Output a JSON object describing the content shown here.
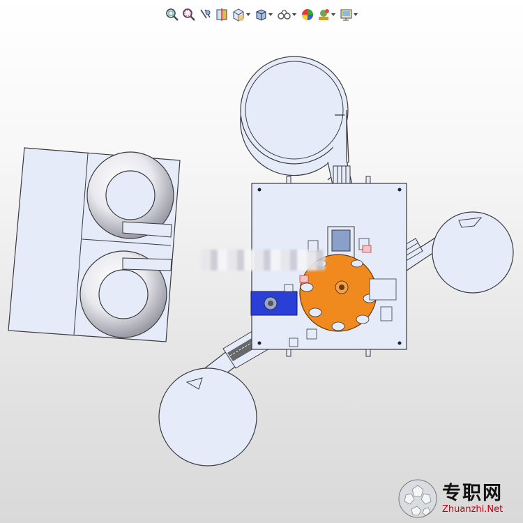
{
  "toolbar": {
    "buttons": [
      {
        "icon": "zoom-to-fit-icon"
      },
      {
        "icon": "zoom-to-area-icon"
      },
      {
        "icon": "previous-view-icon"
      },
      {
        "icon": "section-view-icon"
      },
      {
        "icon": "view-orientation-icon",
        "dropdown": true
      },
      {
        "icon": "display-style-icon",
        "dropdown": true
      },
      {
        "icon": "hide-show-items-icon",
        "dropdown": true
      },
      {
        "icon": "edit-appearance-icon"
      },
      {
        "icon": "apply-scene-icon",
        "dropdown": true
      },
      {
        "icon": "view-settings-icon",
        "dropdown": true
      }
    ]
  },
  "colors": {
    "part_fill": "#e6ebfa",
    "part_stroke": "#3a3a3a",
    "turntable": "#f08a1f",
    "motor_block": "#2a3fd6"
  },
  "watermark": {
    "chinese": "专职网",
    "english": "Zhuanzhi.Net"
  }
}
